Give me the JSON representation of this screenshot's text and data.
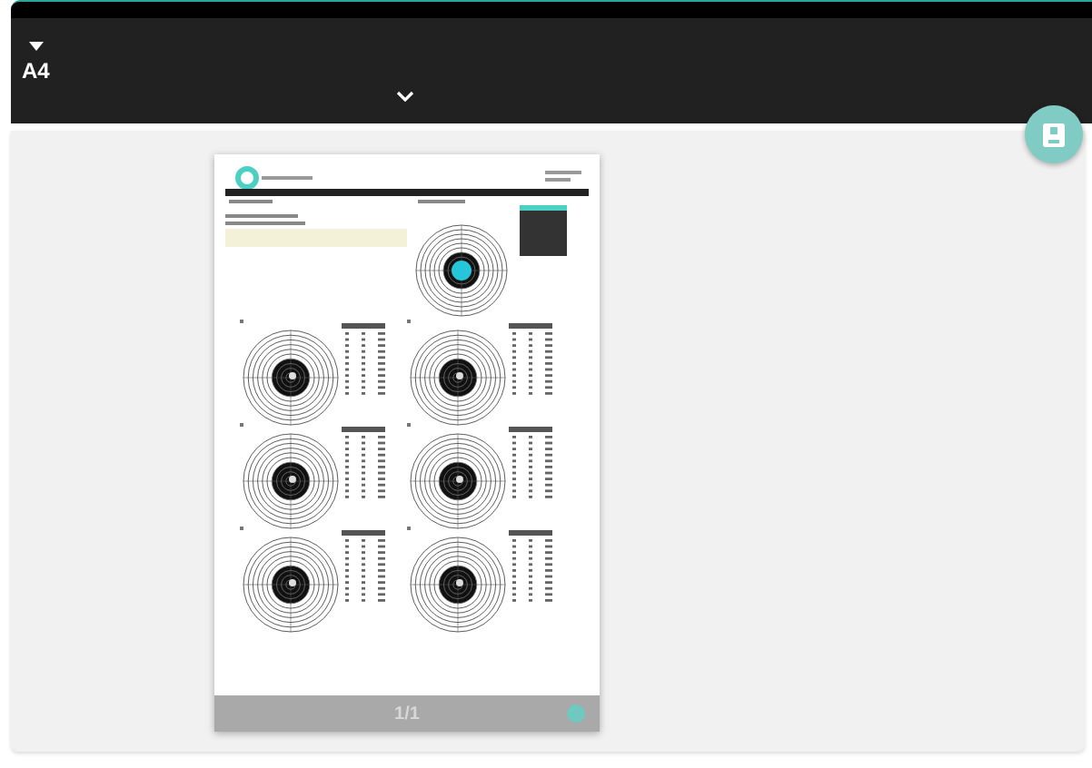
{
  "paper_size": {
    "label": "A4"
  },
  "preview": {
    "page_indicator": "1/1"
  }
}
